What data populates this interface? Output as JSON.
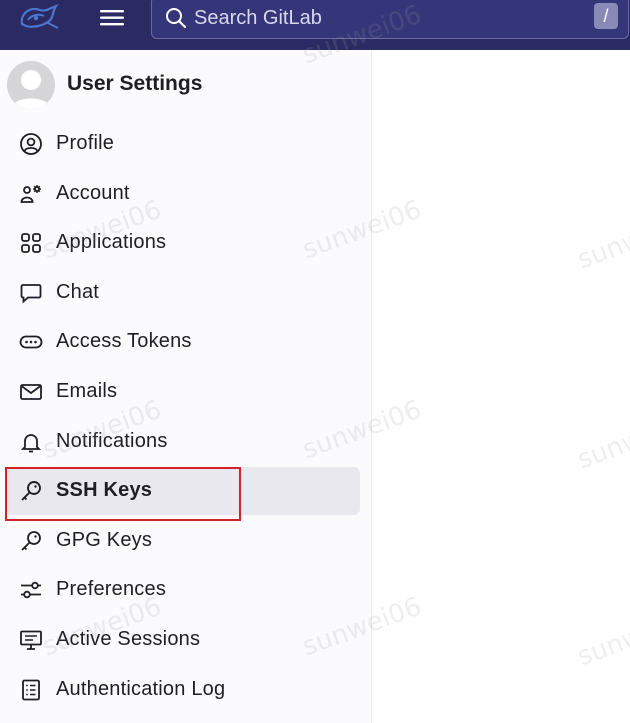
{
  "header": {
    "search": {
      "placeholder": "Search GitLab",
      "shortcut_hint": "/"
    }
  },
  "sidebar": {
    "title": "User Settings",
    "items": [
      {
        "label": "Profile",
        "icon": "profile-icon",
        "active": false
      },
      {
        "label": "Account",
        "icon": "account-icon",
        "active": false
      },
      {
        "label": "Applications",
        "icon": "applications-icon",
        "active": false
      },
      {
        "label": "Chat",
        "icon": "chat-icon",
        "active": false
      },
      {
        "label": "Access Tokens",
        "icon": "token-icon",
        "active": false
      },
      {
        "label": "Emails",
        "icon": "email-icon",
        "active": false
      },
      {
        "label": "Notifications",
        "icon": "bell-icon",
        "active": false
      },
      {
        "label": "SSH Keys",
        "icon": "key-icon",
        "active": true
      },
      {
        "label": "GPG Keys",
        "icon": "key-icon",
        "active": false
      },
      {
        "label": "Preferences",
        "icon": "preferences-icon",
        "active": false
      },
      {
        "label": "Active Sessions",
        "icon": "monitor-icon",
        "active": false
      },
      {
        "label": "Authentication Log",
        "icon": "log-icon",
        "active": false
      }
    ]
  },
  "watermark": {
    "text": "sunwei06"
  },
  "colors": {
    "topbar": "#2b2a63",
    "active_item_bg": "#e9e8ee",
    "highlight_border": "#d0212c"
  }
}
